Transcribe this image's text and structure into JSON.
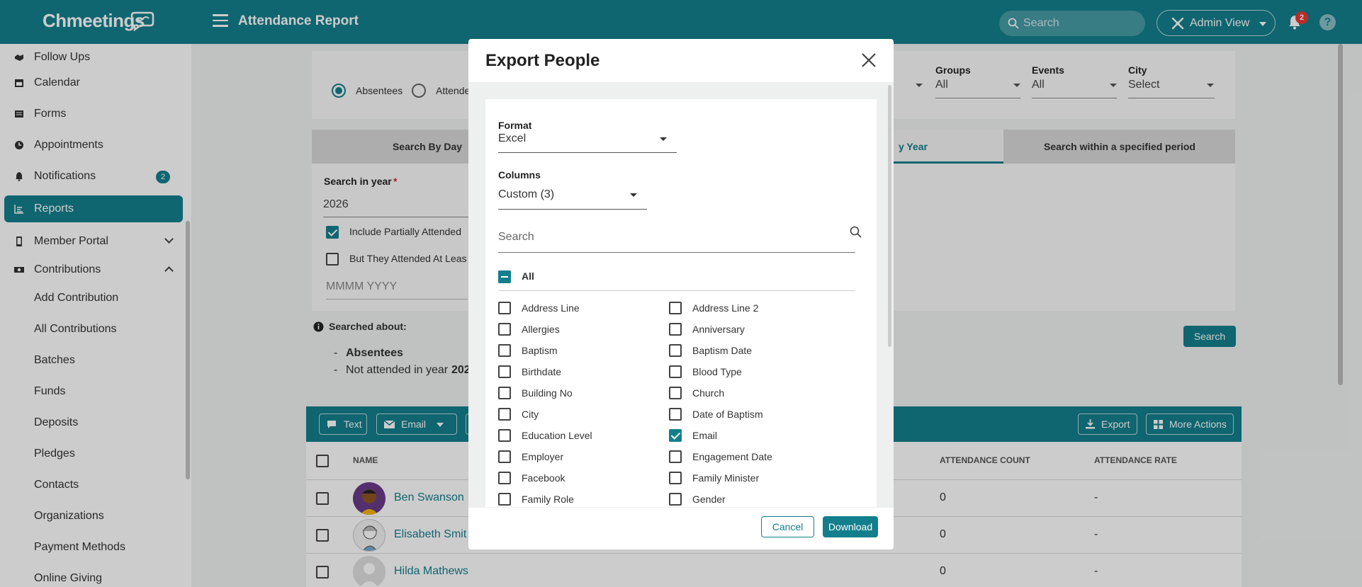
{
  "header": {
    "logo": "Chmeetings",
    "title": "Attendance Report",
    "search_placeholder": "Search",
    "admin_view": "Admin View",
    "notif_count": "2",
    "help": "?"
  },
  "sidebar": {
    "items": [
      {
        "label": "Follow Ups"
      },
      {
        "label": "Calendar"
      },
      {
        "label": "Forms"
      },
      {
        "label": "Appointments"
      },
      {
        "label": "Notifications",
        "badge": "2"
      },
      {
        "label": "Reports"
      },
      {
        "label": "Member Portal"
      },
      {
        "label": "Contributions"
      },
      {
        "label": "Add Contribution"
      },
      {
        "label": "All Contributions"
      },
      {
        "label": "Batches"
      },
      {
        "label": "Funds"
      },
      {
        "label": "Deposits"
      },
      {
        "label": "Pledges"
      },
      {
        "label": "Contacts"
      },
      {
        "label": "Organizations"
      },
      {
        "label": "Payment Methods"
      },
      {
        "label": "Online Giving"
      }
    ]
  },
  "main": {
    "radio_absentees": "Absentees",
    "radio_attendees": "Attende",
    "groups_label": "Groups",
    "groups_value": "All",
    "events_label": "Events",
    "events_value": "All",
    "city_label": "City",
    "city_value": "Select",
    "tabs": [
      {
        "label": "Search By Day"
      },
      {
        "label": "y Year"
      },
      {
        "label": "Search within a specified period"
      }
    ],
    "search_year_label": "Search in year",
    "required_mark": "*",
    "year_value": "2026",
    "include_partial": "Include Partially Attended",
    "attended_least": "But They Attended At Leas",
    "month_placeholder": "MMMM YYYY",
    "searched_about": "Searched about:",
    "summary_1": "Absentees",
    "summary_2_prefix": "Not attended in year",
    "summary_2_year": "202",
    "dash": "-",
    "search_button": "Search",
    "toolbar": {
      "text": "Text",
      "email": "Email",
      "export": "Export",
      "more": "More Actions"
    },
    "table": {
      "col_name": "NAME",
      "col_count": "ATTENDANCE COUNT",
      "col_rate": "ATTENDANCE RATE",
      "rows": [
        {
          "name": "Ben Swanson",
          "count": "0",
          "rate": "-"
        },
        {
          "name": "Elisabeth Smit",
          "count": "0",
          "rate": "-"
        },
        {
          "name": "Hilda Mathews",
          "count": "0",
          "rate": "-"
        }
      ]
    }
  },
  "modal": {
    "title": "Export People",
    "format_label": "Format",
    "format_value": "Excel",
    "columns_label": "Columns",
    "columns_value": "Custom (3)",
    "search_placeholder": "Search",
    "all_label": "All",
    "options": [
      {
        "label": "Address Line",
        "checked": false
      },
      {
        "label": "Address Line 2",
        "checked": false
      },
      {
        "label": "Allergies",
        "checked": false
      },
      {
        "label": "Anniversary",
        "checked": false
      },
      {
        "label": "Baptism",
        "checked": false
      },
      {
        "label": "Baptism Date",
        "checked": false
      },
      {
        "label": "Birthdate",
        "checked": false
      },
      {
        "label": "Blood Type",
        "checked": false
      },
      {
        "label": "Building No",
        "checked": false
      },
      {
        "label": "Church",
        "checked": false
      },
      {
        "label": "City",
        "checked": false
      },
      {
        "label": "Date of Baptism",
        "checked": false
      },
      {
        "label": "Education Level",
        "checked": false
      },
      {
        "label": "Email",
        "checked": true
      },
      {
        "label": "Employer",
        "checked": false
      },
      {
        "label": "Engagement Date",
        "checked": false
      },
      {
        "label": "Facebook",
        "checked": false
      },
      {
        "label": "Family Minister",
        "checked": false
      },
      {
        "label": "Family Role",
        "checked": false
      },
      {
        "label": "Gender",
        "checked": false
      }
    ],
    "cancel": "Cancel",
    "download": "Download"
  },
  "colors": {
    "primary": "#137f8c",
    "badge": "#e53935"
  }
}
